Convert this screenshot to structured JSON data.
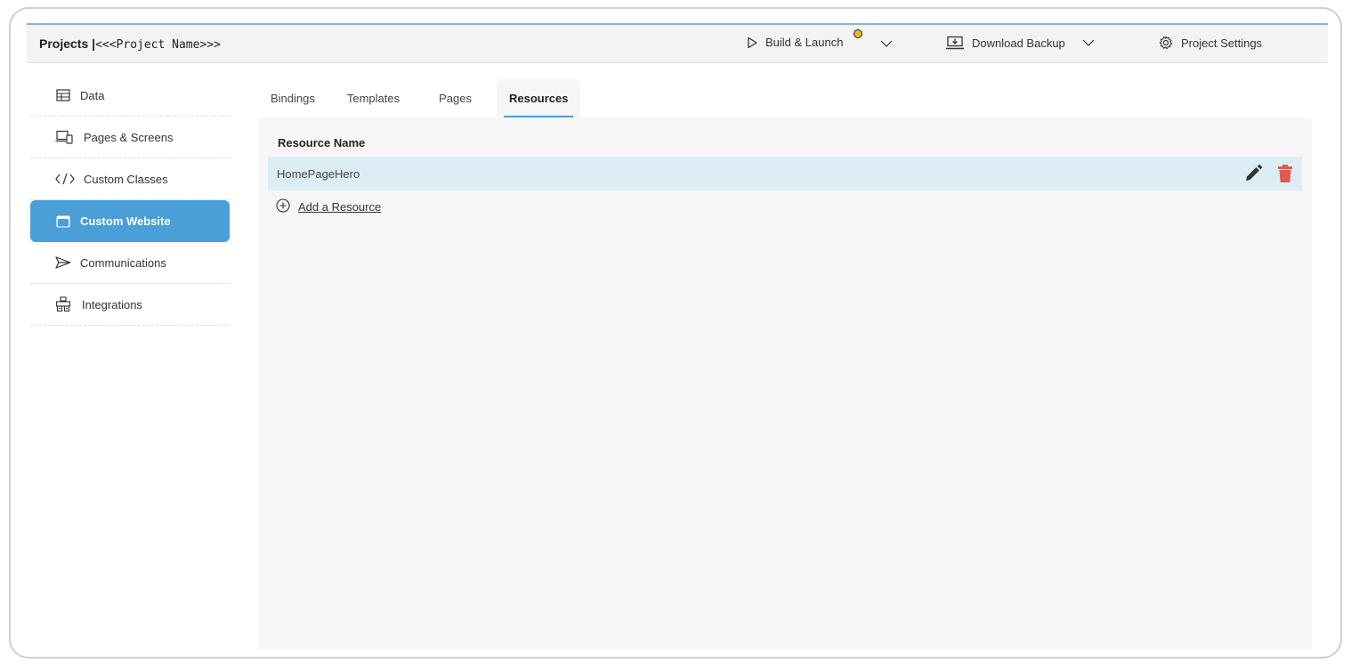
{
  "header": {
    "brand_prefix": "Projects |",
    "project_name": "<<<Project Name>>>",
    "build_launch": "Build & Launch",
    "download_backup": "Download Backup",
    "project_settings": "Project Settings"
  },
  "sidebar": {
    "items": [
      {
        "label": "Data",
        "icon": "table-icon"
      },
      {
        "label": "Pages & Screens",
        "icon": "devices-icon"
      },
      {
        "label": "Custom Classes",
        "icon": "code-icon"
      },
      {
        "label": "Custom Website",
        "icon": "browser-window-icon",
        "active": true
      },
      {
        "label": "Communications",
        "icon": "send-icon"
      },
      {
        "label": "Integrations",
        "icon": "plug-icon"
      }
    ]
  },
  "tabs": [
    {
      "label": "Bindings"
    },
    {
      "label": "Templates"
    },
    {
      "label": "Pages"
    },
    {
      "label": "Resources",
      "active": true
    }
  ],
  "resources": {
    "column_header": "Resource Name",
    "rows": [
      {
        "name": "HomePageHero"
      }
    ],
    "add_label": "Add a Resource"
  },
  "colors": {
    "accent": "#4a9fd9",
    "row_highlight": "#dcedf5",
    "delete": "#e05a47",
    "status_dot": "#f3b324"
  }
}
